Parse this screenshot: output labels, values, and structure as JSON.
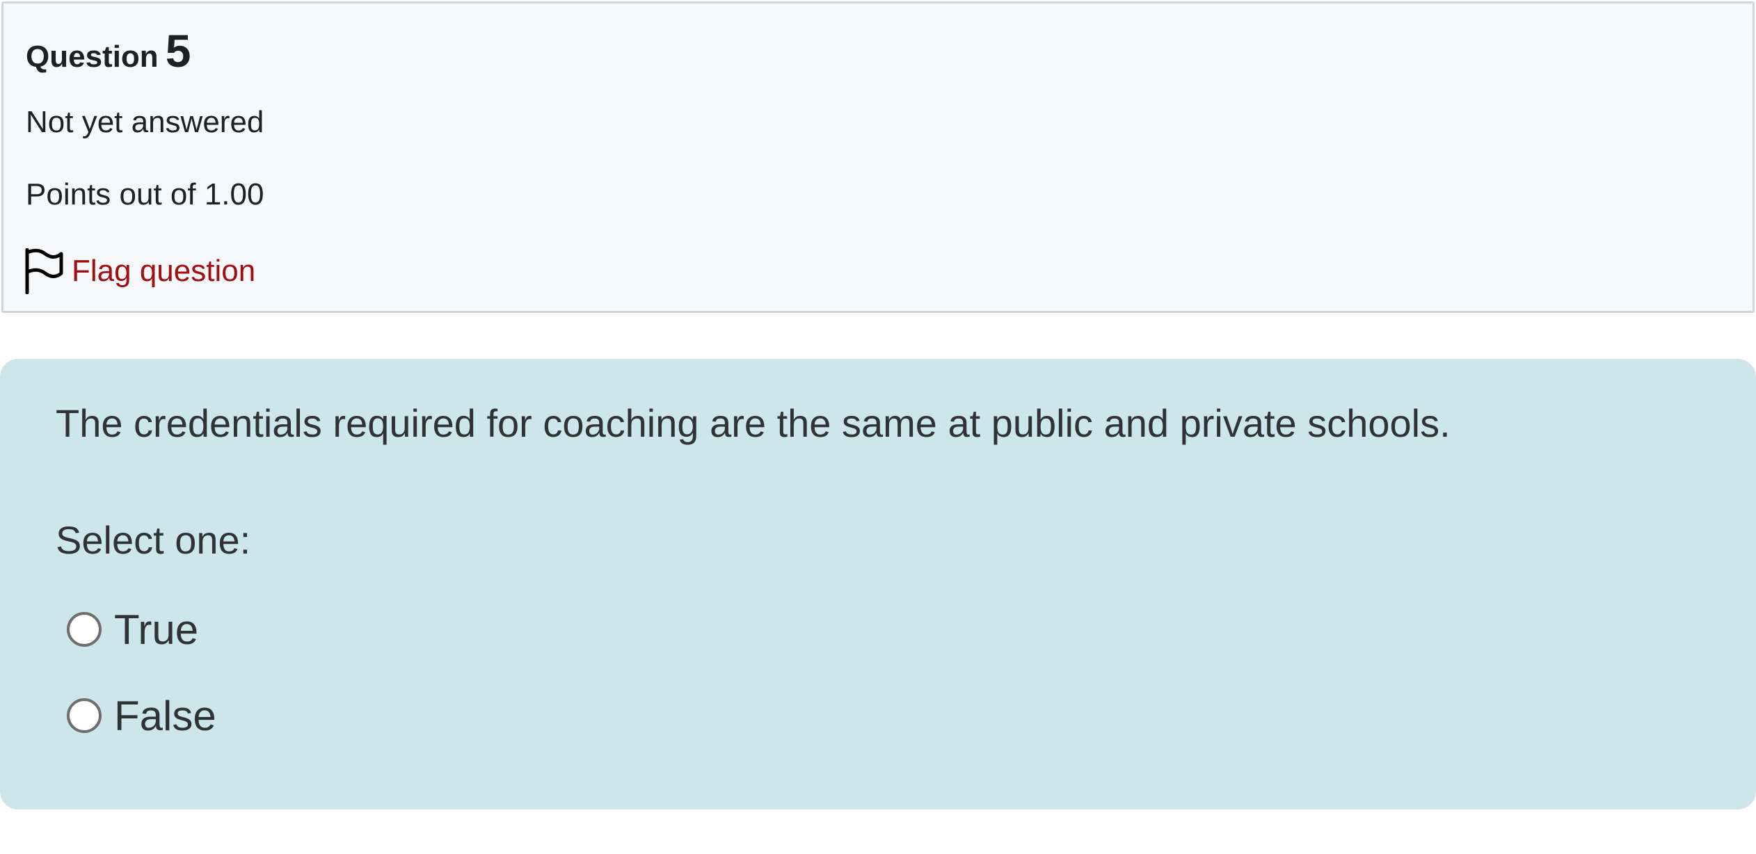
{
  "question_info": {
    "label": "Question",
    "number": "5",
    "state": "Not yet answered",
    "grade": "Points out of 1.00",
    "flag_label": "Flag question",
    "flag_color": "#a00f12"
  },
  "question_content": {
    "text": "The credentials required for coaching are the same at public and private schools.",
    "prompt": "Select one:",
    "background_color": "#cde6ea",
    "options": [
      {
        "label": "True",
        "selected": false
      },
      {
        "label": "False",
        "selected": false
      }
    ]
  }
}
